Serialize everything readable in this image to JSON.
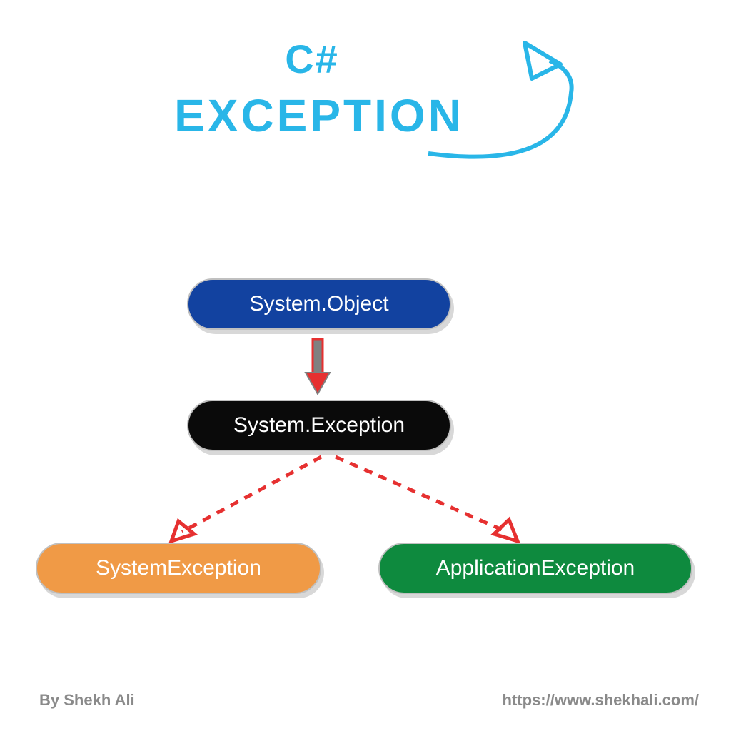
{
  "title": {
    "line1": "C#",
    "line2": "EXCEPTION"
  },
  "nodes": {
    "object": "System.Object",
    "exception": "System.Exception",
    "systemException": "SystemException",
    "applicationException": "ApplicationException"
  },
  "footer": {
    "author": "By Shekh Ali",
    "url": "https://www.shekhali.com/"
  },
  "colors": {
    "titleColor": "#29b6e8",
    "objectBg": "#1242a0",
    "exceptionBg": "#0a0a0a",
    "systemExBg": "#f09a46",
    "appExBg": "#0e8a3e",
    "arrowRed": "#e63030",
    "footerGray": "#8a8a8a"
  },
  "chart_data": {
    "type": "diagram",
    "title": "C# EXCEPTION",
    "description": "Class hierarchy diagram for C# exceptions",
    "nodes": [
      {
        "id": "object",
        "label": "System.Object",
        "level": 0
      },
      {
        "id": "exception",
        "label": "System.Exception",
        "level": 1
      },
      {
        "id": "systemException",
        "label": "SystemException",
        "level": 2
      },
      {
        "id": "applicationException",
        "label": "ApplicationException",
        "level": 2
      }
    ],
    "edges": [
      {
        "from": "object",
        "to": "exception",
        "style": "solid"
      },
      {
        "from": "exception",
        "to": "systemException",
        "style": "dashed"
      },
      {
        "from": "exception",
        "to": "applicationException",
        "style": "dashed"
      }
    ]
  }
}
